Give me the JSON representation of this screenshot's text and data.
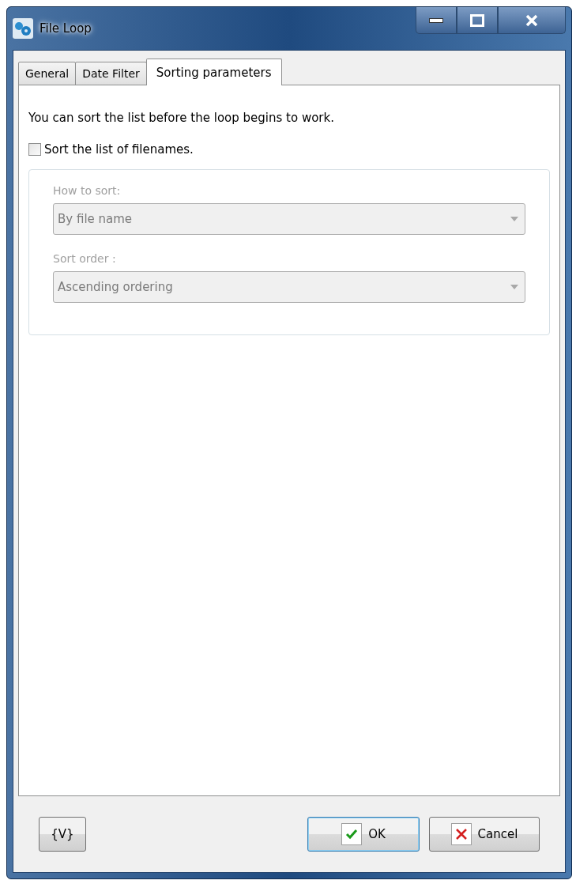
{
  "window": {
    "title": "File Loop"
  },
  "tabs": [
    {
      "label": "General",
      "selected": false
    },
    {
      "label": "Date Filter",
      "selected": false
    },
    {
      "label": "Sorting parameters",
      "selected": true
    }
  ],
  "intro": "You can sort the list before the loop begins to work.",
  "sort_checkbox": {
    "label": "Sort the list of filenames.",
    "checked": false
  },
  "group": {
    "disabled": true,
    "fields": [
      {
        "label": "How to sort:",
        "value": "By file name"
      },
      {
        "label": "Sort order :",
        "value": "Ascending ordering"
      }
    ]
  },
  "buttons": [
    {
      "kind": "variables",
      "label": "{V}",
      "default": false
    },
    {
      "kind": "ok",
      "label": "OK",
      "default": true
    },
    {
      "kind": "cancel",
      "label": "Cancel",
      "default": false
    }
  ]
}
